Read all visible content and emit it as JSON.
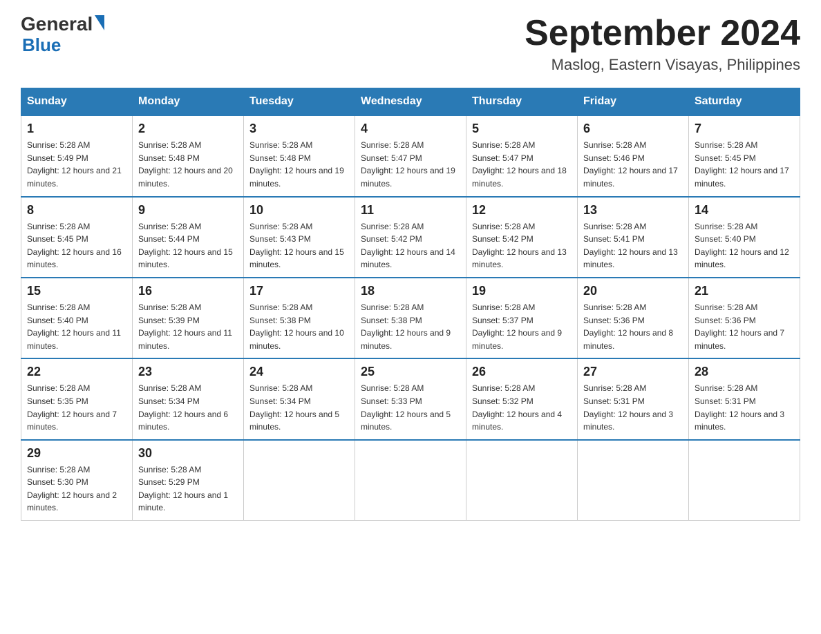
{
  "header": {
    "title": "September 2024",
    "location": "Maslog, Eastern Visayas, Philippines",
    "logo_general": "General",
    "logo_blue": "Blue"
  },
  "days_of_week": [
    "Sunday",
    "Monday",
    "Tuesday",
    "Wednesday",
    "Thursday",
    "Friday",
    "Saturday"
  ],
  "weeks": [
    [
      {
        "day": "1",
        "sunrise": "Sunrise: 5:28 AM",
        "sunset": "Sunset: 5:49 PM",
        "daylight": "Daylight: 12 hours and 21 minutes."
      },
      {
        "day": "2",
        "sunrise": "Sunrise: 5:28 AM",
        "sunset": "Sunset: 5:48 PM",
        "daylight": "Daylight: 12 hours and 20 minutes."
      },
      {
        "day": "3",
        "sunrise": "Sunrise: 5:28 AM",
        "sunset": "Sunset: 5:48 PM",
        "daylight": "Daylight: 12 hours and 19 minutes."
      },
      {
        "day": "4",
        "sunrise": "Sunrise: 5:28 AM",
        "sunset": "Sunset: 5:47 PM",
        "daylight": "Daylight: 12 hours and 19 minutes."
      },
      {
        "day": "5",
        "sunrise": "Sunrise: 5:28 AM",
        "sunset": "Sunset: 5:47 PM",
        "daylight": "Daylight: 12 hours and 18 minutes."
      },
      {
        "day": "6",
        "sunrise": "Sunrise: 5:28 AM",
        "sunset": "Sunset: 5:46 PM",
        "daylight": "Daylight: 12 hours and 17 minutes."
      },
      {
        "day": "7",
        "sunrise": "Sunrise: 5:28 AM",
        "sunset": "Sunset: 5:45 PM",
        "daylight": "Daylight: 12 hours and 17 minutes."
      }
    ],
    [
      {
        "day": "8",
        "sunrise": "Sunrise: 5:28 AM",
        "sunset": "Sunset: 5:45 PM",
        "daylight": "Daylight: 12 hours and 16 minutes."
      },
      {
        "day": "9",
        "sunrise": "Sunrise: 5:28 AM",
        "sunset": "Sunset: 5:44 PM",
        "daylight": "Daylight: 12 hours and 15 minutes."
      },
      {
        "day": "10",
        "sunrise": "Sunrise: 5:28 AM",
        "sunset": "Sunset: 5:43 PM",
        "daylight": "Daylight: 12 hours and 15 minutes."
      },
      {
        "day": "11",
        "sunrise": "Sunrise: 5:28 AM",
        "sunset": "Sunset: 5:42 PM",
        "daylight": "Daylight: 12 hours and 14 minutes."
      },
      {
        "day": "12",
        "sunrise": "Sunrise: 5:28 AM",
        "sunset": "Sunset: 5:42 PM",
        "daylight": "Daylight: 12 hours and 13 minutes."
      },
      {
        "day": "13",
        "sunrise": "Sunrise: 5:28 AM",
        "sunset": "Sunset: 5:41 PM",
        "daylight": "Daylight: 12 hours and 13 minutes."
      },
      {
        "day": "14",
        "sunrise": "Sunrise: 5:28 AM",
        "sunset": "Sunset: 5:40 PM",
        "daylight": "Daylight: 12 hours and 12 minutes."
      }
    ],
    [
      {
        "day": "15",
        "sunrise": "Sunrise: 5:28 AM",
        "sunset": "Sunset: 5:40 PM",
        "daylight": "Daylight: 12 hours and 11 minutes."
      },
      {
        "day": "16",
        "sunrise": "Sunrise: 5:28 AM",
        "sunset": "Sunset: 5:39 PM",
        "daylight": "Daylight: 12 hours and 11 minutes."
      },
      {
        "day": "17",
        "sunrise": "Sunrise: 5:28 AM",
        "sunset": "Sunset: 5:38 PM",
        "daylight": "Daylight: 12 hours and 10 minutes."
      },
      {
        "day": "18",
        "sunrise": "Sunrise: 5:28 AM",
        "sunset": "Sunset: 5:38 PM",
        "daylight": "Daylight: 12 hours and 9 minutes."
      },
      {
        "day": "19",
        "sunrise": "Sunrise: 5:28 AM",
        "sunset": "Sunset: 5:37 PM",
        "daylight": "Daylight: 12 hours and 9 minutes."
      },
      {
        "day": "20",
        "sunrise": "Sunrise: 5:28 AM",
        "sunset": "Sunset: 5:36 PM",
        "daylight": "Daylight: 12 hours and 8 minutes."
      },
      {
        "day": "21",
        "sunrise": "Sunrise: 5:28 AM",
        "sunset": "Sunset: 5:36 PM",
        "daylight": "Daylight: 12 hours and 7 minutes."
      }
    ],
    [
      {
        "day": "22",
        "sunrise": "Sunrise: 5:28 AM",
        "sunset": "Sunset: 5:35 PM",
        "daylight": "Daylight: 12 hours and 7 minutes."
      },
      {
        "day": "23",
        "sunrise": "Sunrise: 5:28 AM",
        "sunset": "Sunset: 5:34 PM",
        "daylight": "Daylight: 12 hours and 6 minutes."
      },
      {
        "day": "24",
        "sunrise": "Sunrise: 5:28 AM",
        "sunset": "Sunset: 5:34 PM",
        "daylight": "Daylight: 12 hours and 5 minutes."
      },
      {
        "day": "25",
        "sunrise": "Sunrise: 5:28 AM",
        "sunset": "Sunset: 5:33 PM",
        "daylight": "Daylight: 12 hours and 5 minutes."
      },
      {
        "day": "26",
        "sunrise": "Sunrise: 5:28 AM",
        "sunset": "Sunset: 5:32 PM",
        "daylight": "Daylight: 12 hours and 4 minutes."
      },
      {
        "day": "27",
        "sunrise": "Sunrise: 5:28 AM",
        "sunset": "Sunset: 5:31 PM",
        "daylight": "Daylight: 12 hours and 3 minutes."
      },
      {
        "day": "28",
        "sunrise": "Sunrise: 5:28 AM",
        "sunset": "Sunset: 5:31 PM",
        "daylight": "Daylight: 12 hours and 3 minutes."
      }
    ],
    [
      {
        "day": "29",
        "sunrise": "Sunrise: 5:28 AM",
        "sunset": "Sunset: 5:30 PM",
        "daylight": "Daylight: 12 hours and 2 minutes."
      },
      {
        "day": "30",
        "sunrise": "Sunrise: 5:28 AM",
        "sunset": "Sunset: 5:29 PM",
        "daylight": "Daylight: 12 hours and 1 minute."
      },
      null,
      null,
      null,
      null,
      null
    ]
  ]
}
